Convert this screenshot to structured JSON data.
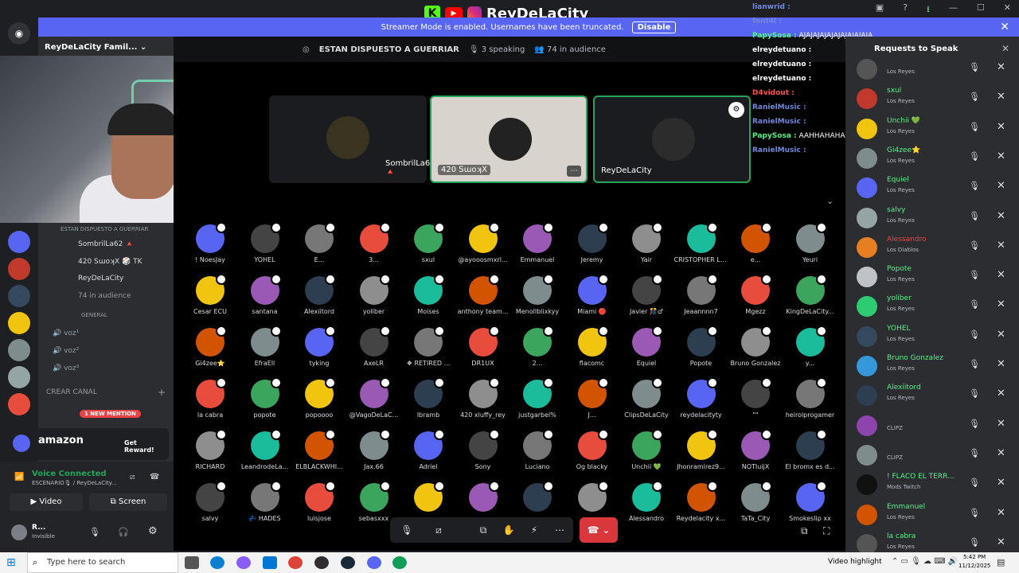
{
  "banner": {
    "text": "Streamer Mode is enabled. Usernames have been truncated.",
    "button": "Disable"
  },
  "overlay": {
    "channel_name": "ReyDeLaCity"
  },
  "server": {
    "name": "ReyDeLaCity Famil..."
  },
  "stage": {
    "title": "ESTAN DISPUESTO A GUERRIAR",
    "speaking": "3 speaking",
    "audience": "74 in audience"
  },
  "speakers": [
    {
      "name": "SombrilLa62 🔺",
      "color": "#3a3320"
    },
    {
      "name": "420 ꓢɯoʞꓫ",
      "color": "#d7d0c8"
    },
    {
      "name": "ReyDeLaCity",
      "color": "#2c2c2c"
    }
  ],
  "audience": [
    [
      "! NoesJay",
      "YOHEL",
      "E...",
      "3...",
      "sxul",
      "@ayooosmxrl...",
      "Emmanuel",
      "Jeremy",
      "Yair",
      "CRISTOPHER LLC...",
      "e...",
      "Yeuri"
    ],
    [
      "Cesar ECU",
      "santana",
      "Alexiitord",
      "yoliber",
      "Moises",
      "anthony team...",
      "Menollblixkyy",
      "Miami 🔴",
      "Javier 🎊♂",
      "Jeaannnn7",
      "Mgezz",
      "KingDeLaCity..."
    ],
    [
      "Gi4zee⭐",
      "EfraEll",
      "tyking",
      "AxeLR",
      "❖ RETIRED ...",
      "DR1UX",
      "2...",
      "flacomc",
      "Equiel",
      "Popote",
      "Bruno Gonzalez",
      "y..."
    ],
    [
      "la cabra",
      "popote",
      "popoooo",
      "@VagoDeLaC...",
      "lbramb",
      "420 xluffy_rey",
      "justgarbel%",
      "J...",
      "ClipsDeLaCity",
      "reydelacityty",
      "\"\"",
      "heirolprogamer"
    ],
    [
      "RICHARD",
      "LeandrodeLa...",
      "ELBLACKWHI...",
      "Jax.66",
      "Adriel",
      "Sony",
      "Luciano",
      "Og blacky",
      "Unchii 💚",
      "Jhonramirez9...",
      "NOTIuijX",
      "El bromx es d..."
    ],
    [
      "salvy",
      "💤 HADES",
      "luisjose",
      "sebasxxx",
      "",
      "",
      "",
      "",
      "Alessandro",
      "Reydelacity x...",
      "TaTa_City",
      "Smokeslip xx"
    ]
  ],
  "chat": [
    {
      "user": "lianwrid",
      "text": "",
      "color": "#7289da"
    },
    {
      "user": "fent4l",
      "text": "",
      "color": "#7289da"
    },
    {
      "user": "PapySosa",
      "text": "AJAJAJAJAJAJAJAJAJAJA",
      "color": "#57f287"
    },
    {
      "user": "elreydetuano",
      "text": "",
      "color": "#ffffff"
    },
    {
      "user": "elreydetuano",
      "text": "",
      "color": "#ffffff"
    },
    {
      "user": "elreydetuano",
      "text": "",
      "color": "#ffffff"
    },
    {
      "user": "D4vidout",
      "text": "",
      "color": "#ff5252"
    },
    {
      "user": "RanielMusic",
      "text": "",
      "color": "#7289da"
    },
    {
      "user": "RanielMusic",
      "text": "",
      "color": "#7289da"
    },
    {
      "user": "PapySosa",
      "text": "AAHHAHAHAHAHHA",
      "color": "#57f287"
    },
    {
      "user": "RanielMusic",
      "text": "",
      "color": "#7289da"
    }
  ],
  "channels": {
    "stage_label": "ESTAN DISPUESTO A GUERRIAR",
    "speakers": [
      "SombrilLa62 🔺",
      "420 ꓢɯoʞꓫ 🎲 TK",
      "ReyDeLaCity"
    ],
    "audience": "74 in audience",
    "general": "GENERAL",
    "voice": [
      "voz¹",
      "voz²",
      "voz³"
    ],
    "create": "CREAR CANAL",
    "mention": "1 NEW MENTION"
  },
  "ad": {
    "brand": "amazon",
    "cta": "Get Reward!"
  },
  "voice": {
    "status": "Voice Connected",
    "channel": "ESCENARIO🎙 / ReyDeLaCity...",
    "video": "Video",
    "screen": "Screen"
  },
  "user": {
    "name": "R...",
    "status": "Invisible"
  },
  "requests": {
    "title": "Requests to Speak",
    "items": [
      {
        "name": "",
        "role": "Los Reyes",
        "ncolor": "#57f287"
      },
      {
        "name": "sxul",
        "role": "Los Reyes",
        "ncolor": "#57f287"
      },
      {
        "name": "Unchii 💚",
        "role": "Los Reyes",
        "ncolor": "#57f287"
      },
      {
        "name": "Gi4zee⭐",
        "role": "Los Reyes",
        "ncolor": "#57f287"
      },
      {
        "name": "Equiel",
        "role": "Los Reyes",
        "ncolor": "#57f287"
      },
      {
        "name": "salvy",
        "role": "Los Reyes",
        "ncolor": "#57f287"
      },
      {
        "name": "Alessandro",
        "role": "Los Diablos",
        "ncolor": "#ed4245"
      },
      {
        "name": "Popote",
        "role": "Los Reyes",
        "ncolor": "#57f287"
      },
      {
        "name": "yoliber",
        "role": "Los Reyes",
        "ncolor": "#57f287"
      },
      {
        "name": "YOHEL",
        "role": "Los Reyes",
        "ncolor": "#57f287"
      },
      {
        "name": "Bruno Gonzalez",
        "role": "Los Reyes",
        "ncolor": "#57f287"
      },
      {
        "name": "Alexiitord",
        "role": "Los Reyes",
        "ncolor": "#57f287"
      },
      {
        "name": "",
        "role": "CLIPZ",
        "ncolor": "#9b59b6"
      },
      {
        "name": "",
        "role": "CLIPZ",
        "ncolor": "#9b59b6"
      },
      {
        "name": "! FLACO EL TERR...",
        "role": "Mods Twitch",
        "ncolor": "#57f287"
      },
      {
        "name": "Emmanuel",
        "role": "Los Reyes",
        "ncolor": "#57f287"
      },
      {
        "name": "la cabra",
        "role": "Los Reyes",
        "ncolor": "#57f287"
      }
    ]
  },
  "taskbar": {
    "search_placeholder": "Type here to search",
    "video_highlight": "Video highlight",
    "time": "5:42 PM",
    "date": "11/12/2025"
  }
}
